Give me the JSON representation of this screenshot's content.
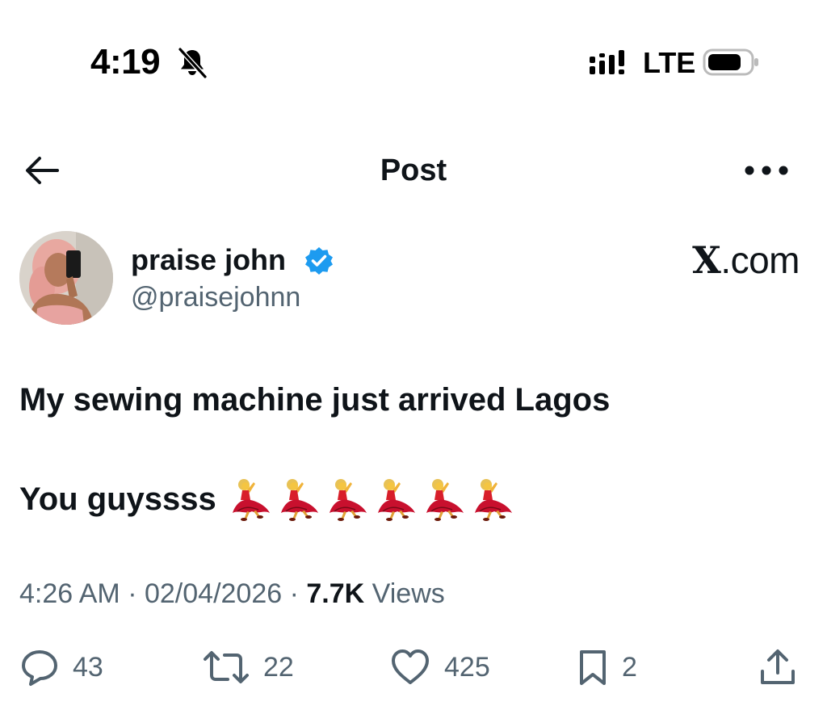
{
  "status_bar": {
    "time": "4:19",
    "network": "LTE",
    "icons": [
      "bell-off-icon",
      "signal-icon",
      "battery-icon"
    ]
  },
  "nav": {
    "title": "Post",
    "back_icon": "arrow-left-icon",
    "more_icon": "more-horizontal-icon"
  },
  "author": {
    "name": "praise john",
    "handle": "@praisejohnn",
    "verified": true
  },
  "watermark": {
    "brand_letter": "X",
    "brand_suffix": ".com"
  },
  "post": {
    "line_1": "My sewing machine just arrived Lagos",
    "line_2": "You guyssss",
    "emoji_name": "dancer-emoji",
    "emoji_count": 6
  },
  "meta": {
    "time": "4:26 AM",
    "separator": "·",
    "date": "02/04/2026",
    "views_count": "7.7K",
    "views_label": "Views"
  },
  "actions": {
    "replies": "43",
    "reposts": "22",
    "likes": "425",
    "bookmarks": "2"
  },
  "colors": {
    "text_primary": "#0f1419",
    "text_secondary": "#536471",
    "verified_blue": "#1d9bf0",
    "background": "#ffffff"
  }
}
